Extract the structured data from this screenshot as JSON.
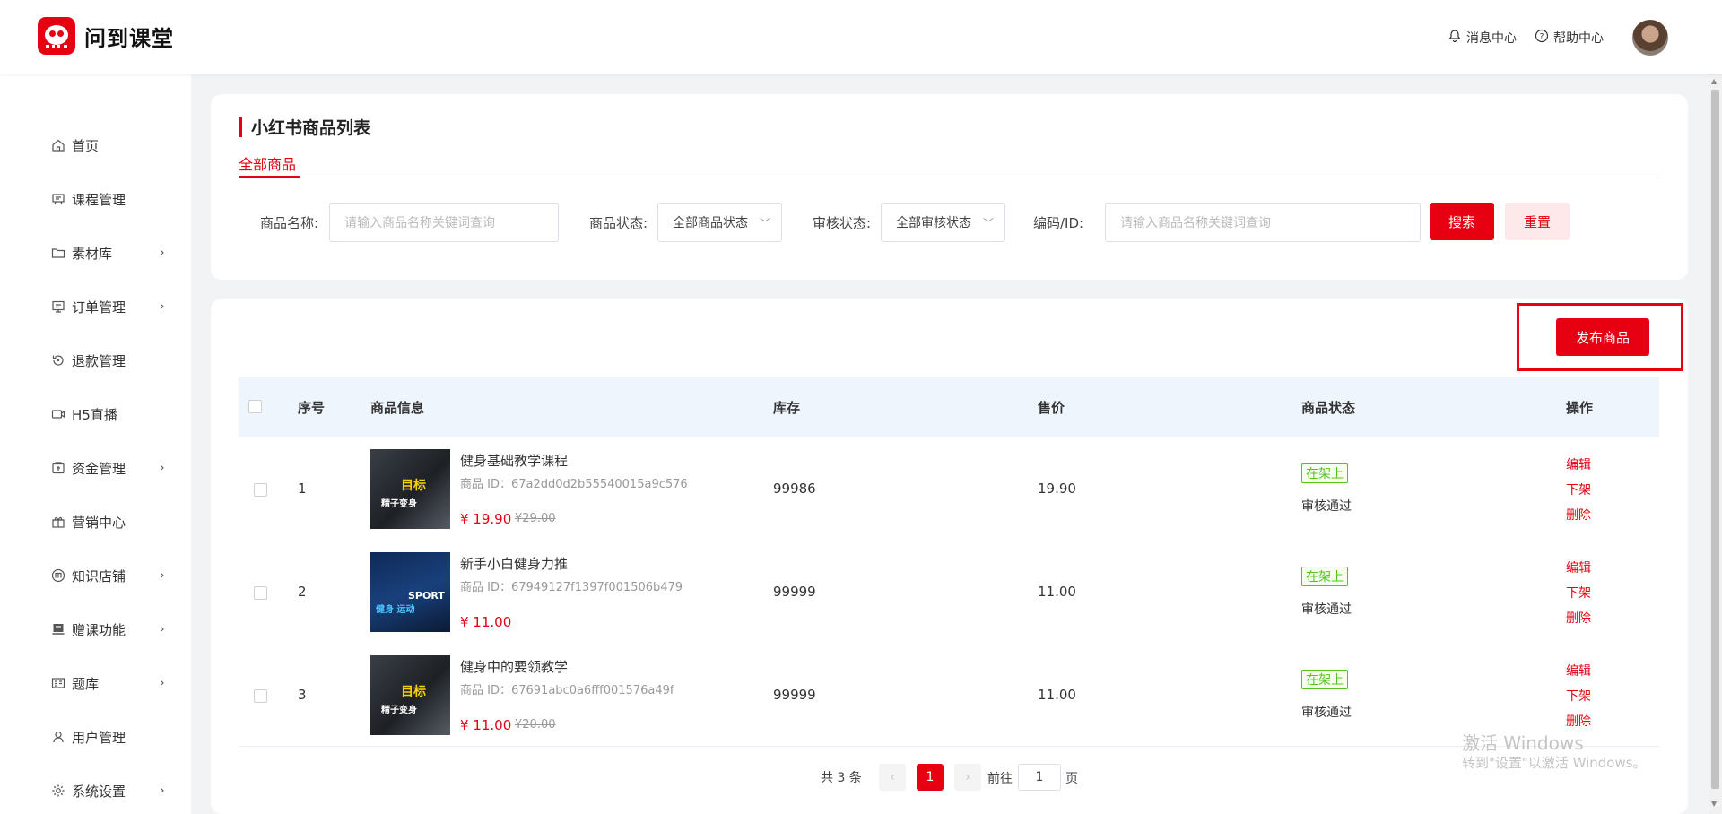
{
  "header": {
    "app_name": "问到课堂",
    "notifications": "消息中心",
    "help": "帮助中心"
  },
  "sidebar": {
    "items": [
      {
        "label": "首页",
        "icon": "home-icon",
        "has_arrow": false
      },
      {
        "label": "课程管理",
        "icon": "course-icon",
        "has_arrow": false
      },
      {
        "label": "素材库",
        "icon": "folder-icon",
        "has_arrow": true
      },
      {
        "label": "订单管理",
        "icon": "order-icon",
        "has_arrow": true
      },
      {
        "label": "退款管理",
        "icon": "refund-icon",
        "has_arrow": false
      },
      {
        "label": "H5直播",
        "icon": "live-icon",
        "has_arrow": false
      },
      {
        "label": "资金管理",
        "icon": "wallet-icon",
        "has_arrow": true
      },
      {
        "label": "营销中心",
        "icon": "gift-icon",
        "has_arrow": false
      },
      {
        "label": "知识店铺",
        "icon": "shop-icon",
        "has_arrow": true
      },
      {
        "label": "赠课功能",
        "icon": "book-gift-icon",
        "has_arrow": true
      },
      {
        "label": "题库",
        "icon": "question-bank-icon",
        "has_arrow": true
      },
      {
        "label": "用户管理",
        "icon": "user-icon",
        "has_arrow": false
      },
      {
        "label": "系统设置",
        "icon": "gear-icon",
        "has_arrow": true
      }
    ]
  },
  "page": {
    "title": "小红书商品列表",
    "tab": "全部商品"
  },
  "filters": {
    "name_label": "商品名称:",
    "name_placeholder": "请输入商品名称关键词查询",
    "status_label": "商品状态:",
    "status_value": "全部商品状态",
    "audit_label": "审核状态:",
    "audit_value": "全部审核状态",
    "code_label": "编码/ID:",
    "code_placeholder": "请输入商品名称关键词查询",
    "search": "搜索",
    "reset": "重置"
  },
  "toolbar": {
    "publish": "发布商品"
  },
  "table": {
    "columns": [
      "序号",
      "商品信息",
      "库存",
      "售价",
      "商品状态",
      "操作"
    ],
    "rows": [
      {
        "index": "1",
        "name": "健身基础教学课程",
        "id": "商品 ID：67a2dd0d2b55540015a9c576",
        "price": "¥ 19.90",
        "old_price": "¥29.00",
        "stock": "99986",
        "sale_price": "19.90",
        "status": "在架上",
        "audit": "审核通过",
        "ops": [
          "编辑",
          "下架",
          "删除"
        ],
        "thumb_title": "目标",
        "thumb_sub": "精子变身"
      },
      {
        "index": "2",
        "name": "新手小白健身力推",
        "id": "商品 ID：67949127f1397f001506b479",
        "price": "¥ 11.00",
        "old_price": "",
        "stock": "99999",
        "sale_price": "11.00",
        "status": "在架上",
        "audit": "审核通过",
        "ops": [
          "编辑",
          "下架",
          "删除"
        ],
        "thumb_title": "SPORT",
        "thumb_sub": "健身 运动"
      },
      {
        "index": "3",
        "name": "健身中的要领教学",
        "id": "商品 ID：67691abc0a6fff001576a49f",
        "price": "¥ 11.00",
        "old_price": "¥20.00",
        "stock": "99999",
        "sale_price": "11.00",
        "status": "在架上",
        "audit": "审核通过",
        "ops": [
          "编辑",
          "下架",
          "删除"
        ],
        "thumb_title": "目标",
        "thumb_sub": "精子变身"
      }
    ]
  },
  "pagination": {
    "total": "共 3 条",
    "current": "1",
    "goto_label": "前往",
    "goto_value": "1",
    "unit": "页"
  },
  "watermark": {
    "line1": "激活 Windows",
    "line2": "转到\"设置\"以激活 Windows。"
  },
  "colors": {
    "accent": "#e60012",
    "success": "#52c41a",
    "table_header_bg": "#eef5fd"
  }
}
